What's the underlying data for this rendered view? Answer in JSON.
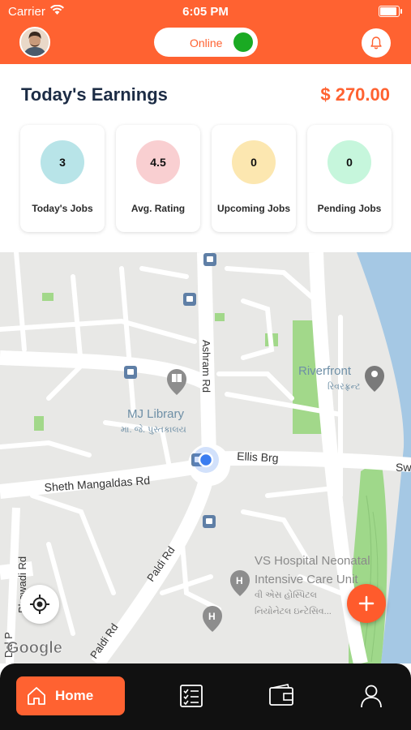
{
  "status_bar": {
    "carrier": "Carrier",
    "time": "6:05 PM"
  },
  "header": {
    "online_label": "Online",
    "online_state": true
  },
  "earnings": {
    "title": "Today's Earnings",
    "amount": "$ 270.00"
  },
  "stats": [
    {
      "value": "3",
      "label": "Today's Jobs",
      "color": "#b8e4e8"
    },
    {
      "value": "4.5",
      "label": "Avg. Rating",
      "color": "#f9cfd1"
    },
    {
      "value": "0",
      "label": "Upcoming Jobs",
      "color": "#fce7b0"
    },
    {
      "value": "0",
      "label": "Pending Jobs",
      "color": "#c6f6dc"
    }
  ],
  "map": {
    "road_labels": [
      "Ashram Rd",
      "Ellis Brg",
      "Sheth Mangaldas Rd",
      "Paldi Rd",
      "Paldi Rd",
      "Bhowadi Rd",
      "Dal P",
      "Sw"
    ],
    "place_labels": [
      "Riverfront",
      "રિવરફ્રન્ટ",
      "MJ Library",
      "મા. જે. પુસ્તકાલય",
      "VS Hospital Neonatal",
      "Intensive Care Unit",
      "વી એસ હોસ્પિટલ",
      "નિયોનેટલ ઇન્ટેસિવ..."
    ],
    "brand": "Google"
  },
  "tabs": {
    "home_label": "Home",
    "icons": [
      "home-icon",
      "checklist-icon",
      "wallet-icon",
      "profile-icon"
    ]
  },
  "colors": {
    "accent": "#ff6231",
    "online": "#1aaa23",
    "dark": "#1c2c45"
  }
}
